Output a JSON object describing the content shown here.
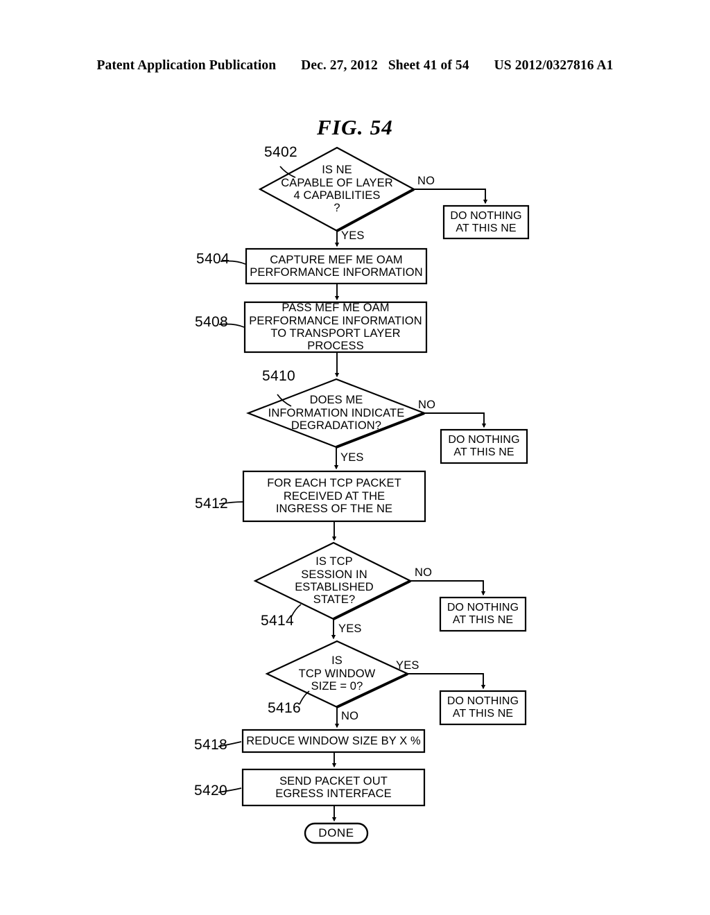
{
  "header": {
    "publication": "Patent Application Publication",
    "date": "Dec. 27, 2012",
    "sheet": "Sheet 41 of 54",
    "docnum": "US 2012/0327816 A1"
  },
  "figure": {
    "title": "FIG. 54"
  },
  "colors": {
    "ink": "#000000",
    "paper": "#ffffff"
  },
  "chart_data": {
    "type": "diagram",
    "diagram_kind": "flowchart",
    "title": "FIG. 54",
    "orientation": "top-to-bottom",
    "nodes": [
      {
        "id": "5402",
        "ref": "5402",
        "shape": "decision",
        "text": "IS NE\nCAPABLE OF LAYER\n4 CAPABILITIES\n?"
      },
      {
        "id": "dn1",
        "ref": "",
        "shape": "process",
        "text": "DO NOTHING\nAT THIS NE"
      },
      {
        "id": "5404",
        "ref": "5404",
        "shape": "process",
        "text": "CAPTURE MEF ME OAM\nPERFORMANCE INFORMATION"
      },
      {
        "id": "5408",
        "ref": "5408",
        "shape": "process",
        "text": "PASS MEF ME OAM\nPERFORMANCE INFORMATION\nTO TRANSPORT LAYER PROCESS"
      },
      {
        "id": "5410",
        "ref": "5410",
        "shape": "decision",
        "text": "DOES ME\nINFORMATION INDICATE\nDEGRADATION?"
      },
      {
        "id": "dn2",
        "ref": "",
        "shape": "process",
        "text": "DO NOTHING\nAT THIS NE"
      },
      {
        "id": "5412",
        "ref": "5412",
        "shape": "process",
        "text": "FOR EACH TCP PACKET\nRECEIVED AT THE\nINGRESS OF THE NE"
      },
      {
        "id": "5414",
        "ref": "5414",
        "shape": "decision",
        "text": "IS TCP\nSESSION IN\nESTABLISHED\nSTATE?"
      },
      {
        "id": "dn3",
        "ref": "",
        "shape": "process",
        "text": "DO NOTHING\nAT THIS NE"
      },
      {
        "id": "5416",
        "ref": "5416",
        "shape": "decision",
        "text": "IS\nTCP WINDOW\nSIZE = 0?"
      },
      {
        "id": "dn4",
        "ref": "",
        "shape": "process",
        "text": "DO NOTHING\nAT THIS NE"
      },
      {
        "id": "5418",
        "ref": "5418",
        "shape": "process",
        "text": "REDUCE WINDOW SIZE BY X %"
      },
      {
        "id": "5420",
        "ref": "5420",
        "shape": "process",
        "text": "SEND PACKET OUT\nEGRESS INTERFACE"
      },
      {
        "id": "done",
        "ref": "",
        "shape": "terminator",
        "text": "DONE"
      }
    ],
    "edges": [
      {
        "from": "5402",
        "to": "dn1",
        "label": "NO"
      },
      {
        "from": "5402",
        "to": "5404",
        "label": "YES"
      },
      {
        "from": "5404",
        "to": "5408",
        "label": ""
      },
      {
        "from": "5408",
        "to": "5410",
        "label": ""
      },
      {
        "from": "5410",
        "to": "dn2",
        "label": "NO"
      },
      {
        "from": "5410",
        "to": "5412",
        "label": "YES"
      },
      {
        "from": "5412",
        "to": "5414",
        "label": ""
      },
      {
        "from": "5414",
        "to": "dn3",
        "label": "NO"
      },
      {
        "from": "5414",
        "to": "5416",
        "label": "YES"
      },
      {
        "from": "5416",
        "to": "dn4",
        "label": "YES"
      },
      {
        "from": "5416",
        "to": "5418",
        "label": "NO"
      },
      {
        "from": "5418",
        "to": "5420",
        "label": ""
      },
      {
        "from": "5420",
        "to": "done",
        "label": ""
      }
    ]
  },
  "nodes": {
    "n5402": {
      "ref": "5402",
      "text": "IS NE\nCAPABLE OF LAYER\n4 CAPABILITIES\n?"
    },
    "n5404": {
      "ref": "5404",
      "text": "CAPTURE MEF ME OAM\nPERFORMANCE INFORMATION"
    },
    "n5408": {
      "ref": "5408",
      "text": "PASS MEF ME OAM\nPERFORMANCE INFORMATION\nTO TRANSPORT LAYER PROCESS"
    },
    "n5410": {
      "ref": "5410",
      "text": "DOES ME\nINFORMATION INDICATE\nDEGRADATION?"
    },
    "n5412": {
      "ref": "5412",
      "text": "FOR EACH TCP PACKET\nRECEIVED AT THE\nINGRESS OF THE NE"
    },
    "n5414": {
      "ref": "5414",
      "text": "IS TCP\nSESSION IN\nESTABLISHED\nSTATE?"
    },
    "n5416": {
      "ref": "5416",
      "text": "IS\nTCP WINDOW\nSIZE = 0?"
    },
    "n5418": {
      "ref": "5418",
      "text": "REDUCE WINDOW SIZE BY X %"
    },
    "n5420": {
      "ref": "5420",
      "text": "SEND PACKET OUT\nEGRESS INTERFACE"
    },
    "donothing1": {
      "text": "DO NOTHING\nAT THIS NE"
    },
    "donothing2": {
      "text": "DO NOTHING\nAT THIS NE"
    },
    "donothing3": {
      "text": "DO NOTHING\nAT THIS NE"
    },
    "donothing4": {
      "text": "DO NOTHING\nAT THIS NE"
    },
    "done": {
      "text": "DONE"
    }
  },
  "labels": {
    "no1": "NO",
    "yes1": "YES",
    "no2": "NO",
    "yes2": "YES",
    "no3": "NO",
    "yes3": "YES",
    "yes4": "YES",
    "no4": "NO"
  }
}
